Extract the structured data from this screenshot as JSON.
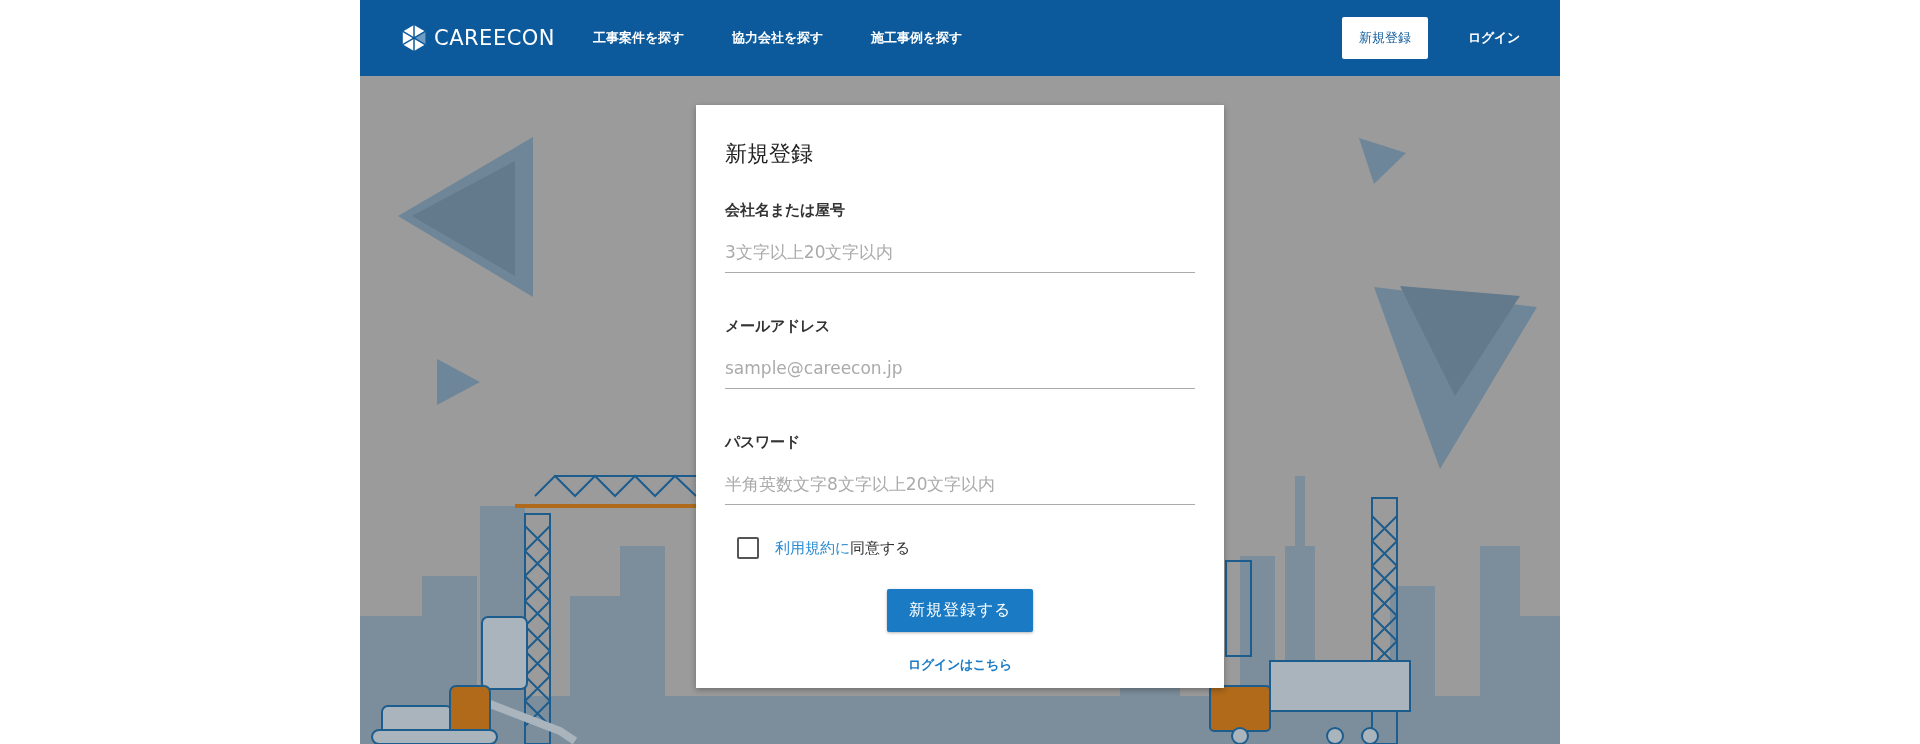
{
  "header": {
    "logo": "CAREECON",
    "nav": [
      "工事案件を探す",
      "協力会社を探す",
      "施工事例を探す"
    ],
    "signup_button": "新規登録",
    "login_link": "ログイン"
  },
  "form": {
    "title": "新規登録",
    "fields": [
      {
        "label": "会社名または屋号",
        "placeholder": "3文字以上20文字以内"
      },
      {
        "label": "メールアドレス",
        "placeholder": "sample@careecon.jp"
      },
      {
        "label": "パスワード",
        "placeholder": "半角英数文字8文字以上20文字以内"
      }
    ],
    "terms": {
      "checked": false,
      "link": "利用規約に",
      "text": "同意する"
    },
    "submit": "新規登録する",
    "login_link": "ログインはこちら"
  }
}
